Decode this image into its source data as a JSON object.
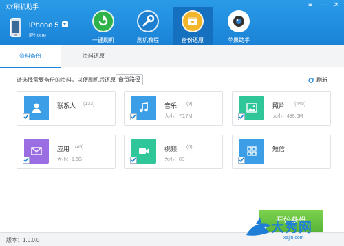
{
  "window": {
    "title": "XY刷机助手",
    "controls": [
      "≡",
      "—",
      "✕"
    ]
  },
  "device": {
    "name": "iPhone 5",
    "model": "iPhone"
  },
  "nav": [
    {
      "label": "一键刷机",
      "icon": "refresh-circle-icon",
      "color": "#2db34a"
    },
    {
      "label": "刷机教程",
      "icon": "wrench-icon",
      "color": "#1d7fd0"
    },
    {
      "label": "备份还原",
      "icon": "archive-box-icon",
      "color": "#f3b62a",
      "active": true
    },
    {
      "label": "苹果助手",
      "icon": "camera-lens-icon",
      "color": "#ffffff"
    }
  ],
  "tabs": [
    {
      "label": "资料备份",
      "active": true
    },
    {
      "label": "资料还原",
      "active": false
    }
  ],
  "toolbar": {
    "hint": "请选择需要备份的资料，以便刷机后还原:",
    "path_button": "备份路径",
    "refresh": "刷新"
  },
  "cards": [
    {
      "name": "联系人",
      "count": "(133)",
      "size": "",
      "icon": "contact-icon",
      "color": "#3b9ee6"
    },
    {
      "name": "音乐",
      "count": "(9)",
      "size": "大小：70.7M",
      "icon": "music-note-icon",
      "color": "#3b9ee6"
    },
    {
      "name": "照片",
      "count": "(445)",
      "size": "大小：488.0M",
      "icon": "photo-icon",
      "color": "#2fc79a"
    },
    {
      "name": "应用",
      "count": "(45)",
      "size": "大小：1.6G",
      "icon": "mail-icon",
      "color": "#9b6de2"
    },
    {
      "name": "视频",
      "count": "(0)",
      "size": "大小：0B",
      "icon": "video-camera-icon",
      "color": "#2fc79a"
    },
    {
      "name": "短信",
      "count": "(0)",
      "size": "",
      "icon": "grid-icon",
      "color": "#3b9ee6"
    }
  ],
  "start_button": "开始备份",
  "status": {
    "version": "版本：1.0.0.0"
  },
  "watermark": {
    "text": "大秀网",
    "sub": "xajjn.com"
  },
  "colors": {
    "header": "#1a82d6",
    "accent": "#1a82d6",
    "start": "#58b43a"
  }
}
